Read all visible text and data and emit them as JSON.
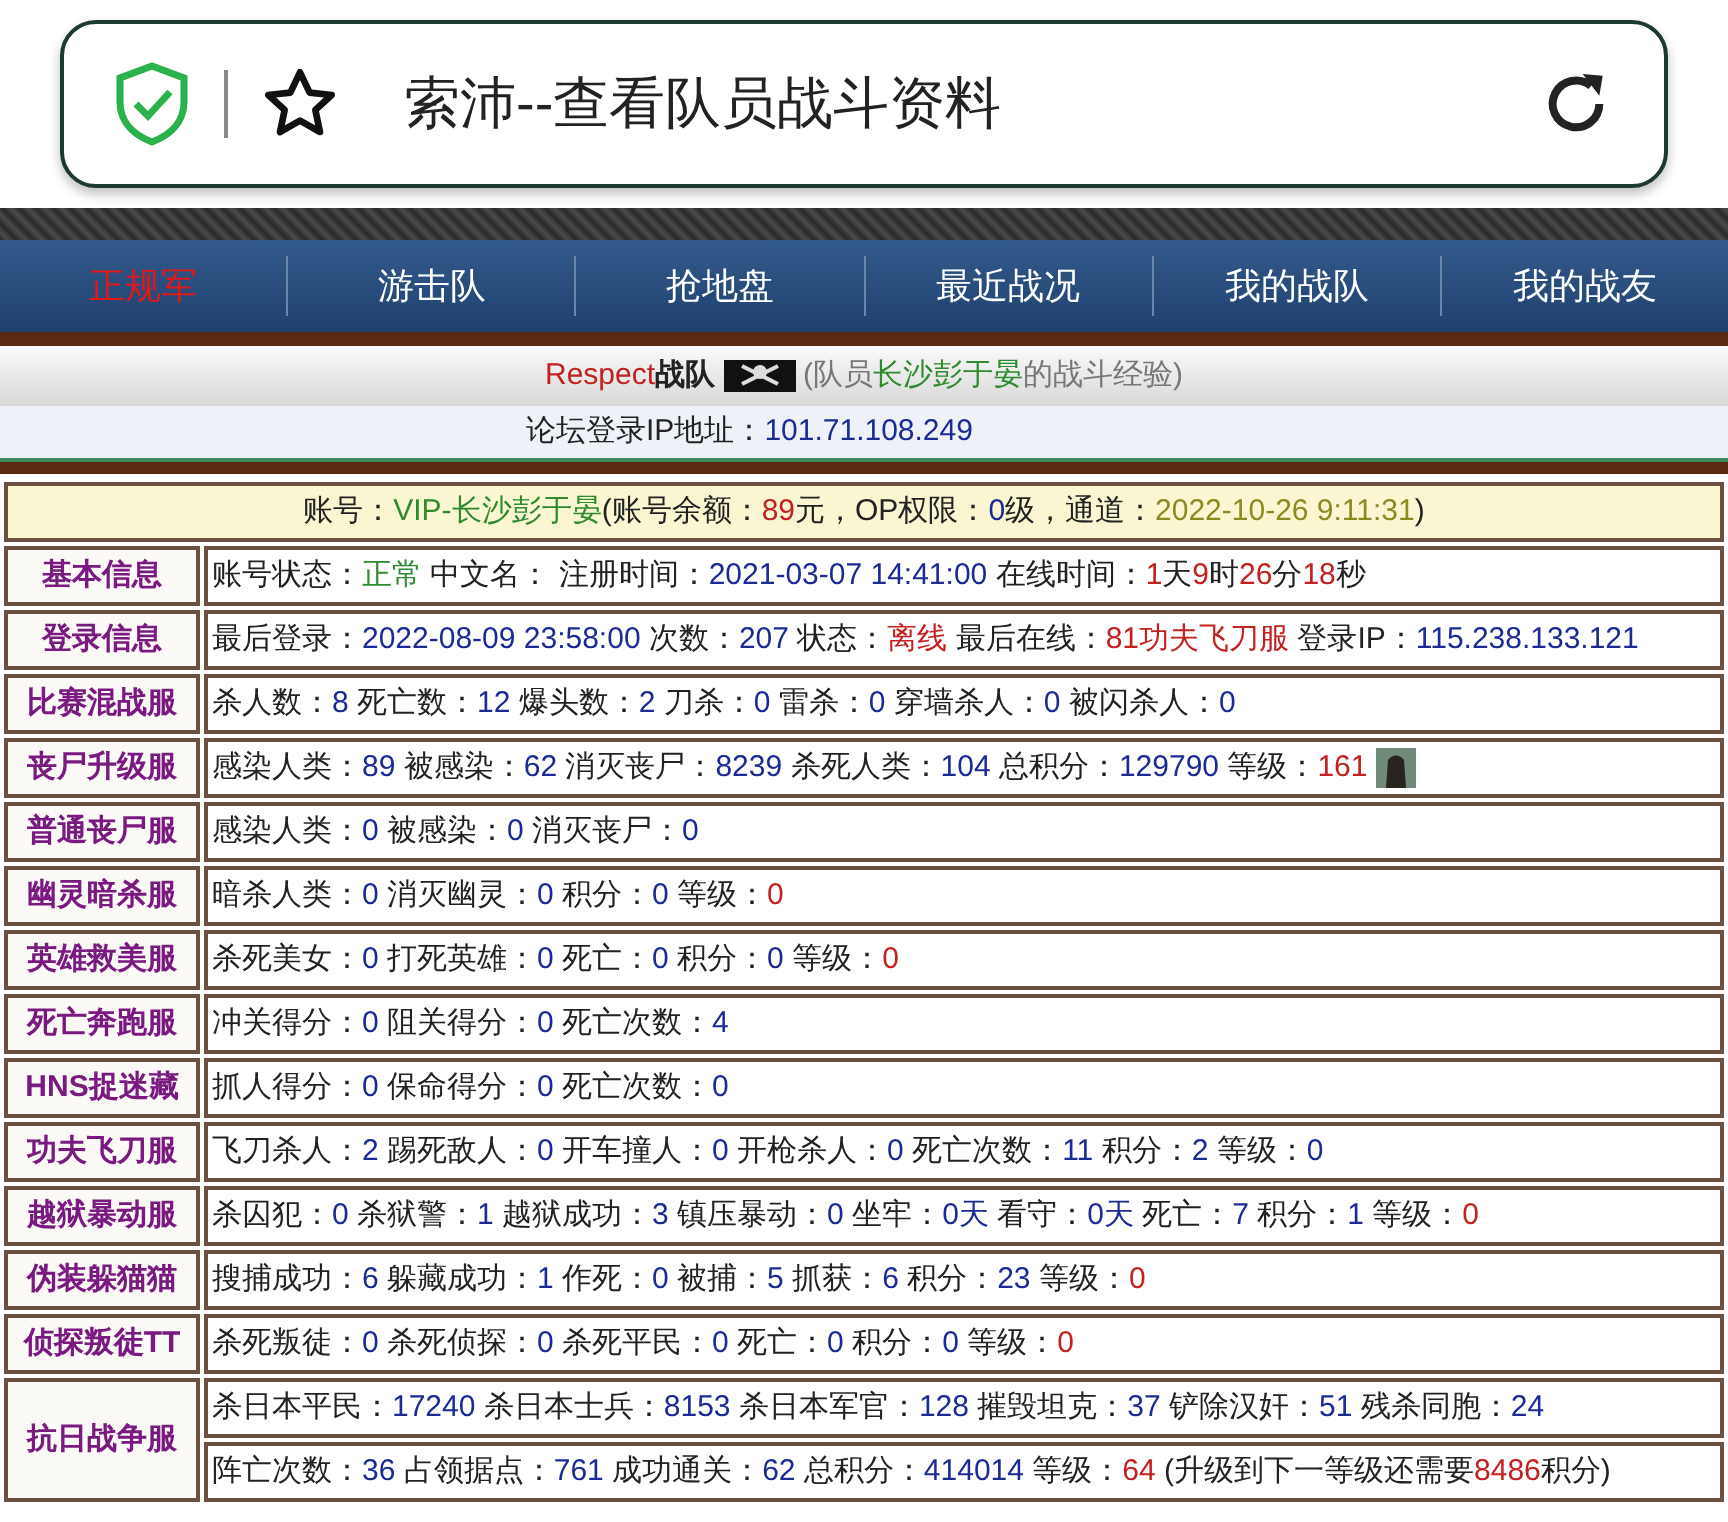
{
  "browser": {
    "title": "索沛--查看队员战斗资料"
  },
  "nav": [
    {
      "label": "正规军",
      "selected": true
    },
    {
      "label": "游击队",
      "selected": false
    },
    {
      "label": "抢地盘",
      "selected": false
    },
    {
      "label": "最近战况",
      "selected": false
    },
    {
      "label": "我的战队",
      "selected": false
    },
    {
      "label": "我的战友",
      "selected": false
    }
  ],
  "team_header": [
    {
      "text": "Respect",
      "kind": "warn"
    },
    {
      "text": "战队",
      "kind": "strong"
    },
    {
      "text": "(队员",
      "kind": "muted"
    },
    {
      "text": "长沙彭于晏",
      "kind": "good"
    },
    {
      "text": "的战斗经验)",
      "kind": "muted"
    }
  ],
  "ip_line": [
    {
      "text": "论坛登录IP地址：",
      "kind": "plain"
    },
    {
      "text": "101.71.108.249",
      "kind": "value"
    }
  ],
  "account_line": [
    {
      "text": "账号：",
      "kind": "plain"
    },
    {
      "text": "VIP-长沙彭于晏",
      "kind": "good"
    },
    {
      "text": "(账号余额：",
      "kind": "plain"
    },
    {
      "text": "89",
      "kind": "warn"
    },
    {
      "text": "元，OP权限：",
      "kind": "plain"
    },
    {
      "text": "0",
      "kind": "value"
    },
    {
      "text": "级，通道：",
      "kind": "plain"
    },
    {
      "text": "2022-10-26 9:11:31",
      "kind": "date"
    },
    {
      "text": ")",
      "kind": "plain"
    }
  ],
  "rows": [
    {
      "label": "基本信息",
      "lines": [
        [
          {
            "text": "账号状态：",
            "kind": "plain"
          },
          {
            "text": "正常",
            "kind": "good"
          },
          {
            "text": " 中文名： 注册时间：",
            "kind": "plain"
          },
          {
            "text": "2021-03-07 14:41:00",
            "kind": "value"
          },
          {
            "text": " 在线时间：",
            "kind": "plain"
          },
          {
            "text": "1",
            "kind": "warn"
          },
          {
            "text": "天",
            "kind": "plain"
          },
          {
            "text": "9",
            "kind": "warn"
          },
          {
            "text": "时",
            "kind": "plain"
          },
          {
            "text": "26",
            "kind": "warn"
          },
          {
            "text": "分",
            "kind": "plain"
          },
          {
            "text": "18",
            "kind": "warn"
          },
          {
            "text": "秒",
            "kind": "plain"
          }
        ]
      ]
    },
    {
      "label": "登录信息",
      "lines": [
        [
          {
            "text": "最后登录：",
            "kind": "plain"
          },
          {
            "text": "2022-08-09 23:58:00",
            "kind": "value"
          },
          {
            "text": " 次数：",
            "kind": "plain"
          },
          {
            "text": "207",
            "kind": "value"
          },
          {
            "text": " 状态：",
            "kind": "plain"
          },
          {
            "text": "离线",
            "kind": "warn"
          },
          {
            "text": " 最后在线：",
            "kind": "plain"
          },
          {
            "text": "81功夫飞刀服",
            "kind": "warn"
          },
          {
            "text": " 登录IP：",
            "kind": "plain"
          },
          {
            "text": "115.238.133.121",
            "kind": "value"
          }
        ]
      ]
    },
    {
      "label": "比赛混战服",
      "lines": [
        [
          {
            "text": "杀人数：",
            "kind": "plain"
          },
          {
            "text": "8",
            "kind": "value"
          },
          {
            "text": " 死亡数：",
            "kind": "plain"
          },
          {
            "text": "12",
            "kind": "value"
          },
          {
            "text": " 爆头数：",
            "kind": "plain"
          },
          {
            "text": "2",
            "kind": "value"
          },
          {
            "text": " 刀杀：",
            "kind": "plain"
          },
          {
            "text": "0",
            "kind": "value"
          },
          {
            "text": " 雷杀：",
            "kind": "plain"
          },
          {
            "text": "0",
            "kind": "value"
          },
          {
            "text": " 穿墙杀人：",
            "kind": "plain"
          },
          {
            "text": "0",
            "kind": "value"
          },
          {
            "text": " 被闪杀人：",
            "kind": "plain"
          },
          {
            "text": "0",
            "kind": "value"
          }
        ]
      ]
    },
    {
      "label": "丧尸升级服",
      "rank_icon": true,
      "lines": [
        [
          {
            "text": "感染人类：",
            "kind": "plain"
          },
          {
            "text": "89",
            "kind": "value"
          },
          {
            "text": " 被感染：",
            "kind": "plain"
          },
          {
            "text": "62",
            "kind": "value"
          },
          {
            "text": " 消灭丧尸：",
            "kind": "plain"
          },
          {
            "text": "8239",
            "kind": "value"
          },
          {
            "text": " 杀死人类：",
            "kind": "plain"
          },
          {
            "text": "104",
            "kind": "value"
          },
          {
            "text": " 总积分：",
            "kind": "plain"
          },
          {
            "text": "129790",
            "kind": "value"
          },
          {
            "text": " 等级：",
            "kind": "plain"
          },
          {
            "text": "161",
            "kind": "warn"
          }
        ]
      ]
    },
    {
      "label": "普通丧尸服",
      "lines": [
        [
          {
            "text": "感染人类：",
            "kind": "plain"
          },
          {
            "text": "0",
            "kind": "value"
          },
          {
            "text": " 被感染：",
            "kind": "plain"
          },
          {
            "text": "0",
            "kind": "value"
          },
          {
            "text": " 消灭丧尸：",
            "kind": "plain"
          },
          {
            "text": "0",
            "kind": "value"
          }
        ]
      ]
    },
    {
      "label": "幽灵暗杀服",
      "lines": [
        [
          {
            "text": "暗杀人类：",
            "kind": "plain"
          },
          {
            "text": "0",
            "kind": "value"
          },
          {
            "text": " 消灭幽灵：",
            "kind": "plain"
          },
          {
            "text": "0",
            "kind": "value"
          },
          {
            "text": " 积分：",
            "kind": "plain"
          },
          {
            "text": "0",
            "kind": "value"
          },
          {
            "text": " 等级：",
            "kind": "plain"
          },
          {
            "text": "0",
            "kind": "warn"
          }
        ]
      ]
    },
    {
      "label": "英雄救美服",
      "lines": [
        [
          {
            "text": "杀死美女：",
            "kind": "plain"
          },
          {
            "text": "0",
            "kind": "value"
          },
          {
            "text": " 打死英雄：",
            "kind": "plain"
          },
          {
            "text": "0",
            "kind": "value"
          },
          {
            "text": " 死亡：",
            "kind": "plain"
          },
          {
            "text": "0",
            "kind": "value"
          },
          {
            "text": " 积分：",
            "kind": "plain"
          },
          {
            "text": "0",
            "kind": "value"
          },
          {
            "text": " 等级：",
            "kind": "plain"
          },
          {
            "text": "0",
            "kind": "warn"
          }
        ]
      ]
    },
    {
      "label": "死亡奔跑服",
      "lines": [
        [
          {
            "text": "冲关得分：",
            "kind": "plain"
          },
          {
            "text": "0",
            "kind": "value"
          },
          {
            "text": " 阻关得分：",
            "kind": "plain"
          },
          {
            "text": "0",
            "kind": "value"
          },
          {
            "text": " 死亡次数：",
            "kind": "plain"
          },
          {
            "text": "4",
            "kind": "value"
          }
        ]
      ]
    },
    {
      "label": "HNS捉迷藏",
      "lines": [
        [
          {
            "text": "抓人得分：",
            "kind": "plain"
          },
          {
            "text": "0",
            "kind": "value"
          },
          {
            "text": " 保命得分：",
            "kind": "plain"
          },
          {
            "text": "0",
            "kind": "value"
          },
          {
            "text": " 死亡次数：",
            "kind": "plain"
          },
          {
            "text": "0",
            "kind": "value"
          }
        ]
      ]
    },
    {
      "label": "功夫飞刀服",
      "lines": [
        [
          {
            "text": "飞刀杀人：",
            "kind": "plain"
          },
          {
            "text": "2",
            "kind": "value"
          },
          {
            "text": " 踢死敌人：",
            "kind": "plain"
          },
          {
            "text": "0",
            "kind": "value"
          },
          {
            "text": " 开车撞人：",
            "kind": "plain"
          },
          {
            "text": "0",
            "kind": "value"
          },
          {
            "text": " 开枪杀人：",
            "kind": "plain"
          },
          {
            "text": "0",
            "kind": "value"
          },
          {
            "text": " 死亡次数：",
            "kind": "plain"
          },
          {
            "text": "11",
            "kind": "value"
          },
          {
            "text": " 积分：",
            "kind": "plain"
          },
          {
            "text": "2",
            "kind": "value"
          },
          {
            "text": " 等级：",
            "kind": "plain"
          },
          {
            "text": "0",
            "kind": "value"
          }
        ]
      ]
    },
    {
      "label": "越狱暴动服",
      "lines": [
        [
          {
            "text": "杀囚犯：",
            "kind": "plain"
          },
          {
            "text": "0",
            "kind": "value"
          },
          {
            "text": " 杀狱警：",
            "kind": "plain"
          },
          {
            "text": "1",
            "kind": "value"
          },
          {
            "text": " 越狱成功：",
            "kind": "plain"
          },
          {
            "text": "3",
            "kind": "value"
          },
          {
            "text": " 镇压暴动：",
            "kind": "plain"
          },
          {
            "text": "0",
            "kind": "value"
          },
          {
            "text": " 坐牢：",
            "kind": "plain"
          },
          {
            "text": "0天",
            "kind": "value"
          },
          {
            "text": " 看守：",
            "kind": "plain"
          },
          {
            "text": "0天",
            "kind": "value"
          },
          {
            "text": " 死亡：",
            "kind": "plain"
          },
          {
            "text": "7",
            "kind": "value"
          },
          {
            "text": " 积分：",
            "kind": "plain"
          },
          {
            "text": "1",
            "kind": "value"
          },
          {
            "text": " 等级：",
            "kind": "plain"
          },
          {
            "text": "0",
            "kind": "warn"
          }
        ]
      ]
    },
    {
      "label": "伪装躲猫猫",
      "lines": [
        [
          {
            "text": "搜捕成功：",
            "kind": "plain"
          },
          {
            "text": "6",
            "kind": "value"
          },
          {
            "text": " 躲藏成功：",
            "kind": "plain"
          },
          {
            "text": "1",
            "kind": "value"
          },
          {
            "text": " 作死：",
            "kind": "plain"
          },
          {
            "text": "0",
            "kind": "value"
          },
          {
            "text": " 被捕：",
            "kind": "plain"
          },
          {
            "text": "5",
            "kind": "value"
          },
          {
            "text": " 抓获：",
            "kind": "plain"
          },
          {
            "text": "6",
            "kind": "value"
          },
          {
            "text": " 积分：",
            "kind": "plain"
          },
          {
            "text": "23",
            "kind": "value"
          },
          {
            "text": " 等级：",
            "kind": "plain"
          },
          {
            "text": "0",
            "kind": "warn"
          }
        ]
      ]
    },
    {
      "label": "侦探叛徒TT",
      "lines": [
        [
          {
            "text": "杀死叛徒：",
            "kind": "plain"
          },
          {
            "text": "0",
            "kind": "value"
          },
          {
            "text": " 杀死侦探：",
            "kind": "plain"
          },
          {
            "text": "0",
            "kind": "value"
          },
          {
            "text": " 杀死平民：",
            "kind": "plain"
          },
          {
            "text": "0",
            "kind": "value"
          },
          {
            "text": " 死亡：",
            "kind": "plain"
          },
          {
            "text": "0",
            "kind": "value"
          },
          {
            "text": " 积分：",
            "kind": "plain"
          },
          {
            "text": "0",
            "kind": "value"
          },
          {
            "text": " 等级：",
            "kind": "plain"
          },
          {
            "text": "0",
            "kind": "warn"
          }
        ]
      ]
    },
    {
      "label": "抗日战争服",
      "lines": [
        [
          {
            "text": "杀日本平民：",
            "kind": "plain"
          },
          {
            "text": "17240",
            "kind": "value"
          },
          {
            "text": " 杀日本士兵：",
            "kind": "plain"
          },
          {
            "text": "8153",
            "kind": "value"
          },
          {
            "text": " 杀日本军官：",
            "kind": "plain"
          },
          {
            "text": "128",
            "kind": "value"
          },
          {
            "text": " 摧毁坦克：",
            "kind": "plain"
          },
          {
            "text": "37",
            "kind": "value"
          },
          {
            "text": " 铲除汉奸：",
            "kind": "plain"
          },
          {
            "text": "51",
            "kind": "value"
          },
          {
            "text": " 残杀同胞：",
            "kind": "plain"
          },
          {
            "text": "24",
            "kind": "value"
          }
        ],
        [
          {
            "text": "阵亡次数：",
            "kind": "plain"
          },
          {
            "text": "36",
            "kind": "value"
          },
          {
            "text": " 占领据点：",
            "kind": "plain"
          },
          {
            "text": "761",
            "kind": "value"
          },
          {
            "text": " 成功通关：",
            "kind": "plain"
          },
          {
            "text": "62",
            "kind": "value"
          },
          {
            "text": " 总积分：",
            "kind": "plain"
          },
          {
            "text": "414014",
            "kind": "value"
          },
          {
            "text": " 等级：",
            "kind": "plain"
          },
          {
            "text": "64",
            "kind": "warn"
          },
          {
            "text": " (升级到下一等级还需要",
            "kind": "plain"
          },
          {
            "text": "8486",
            "kind": "warn"
          },
          {
            "text": "积分)",
            "kind": "plain"
          }
        ]
      ]
    }
  ]
}
